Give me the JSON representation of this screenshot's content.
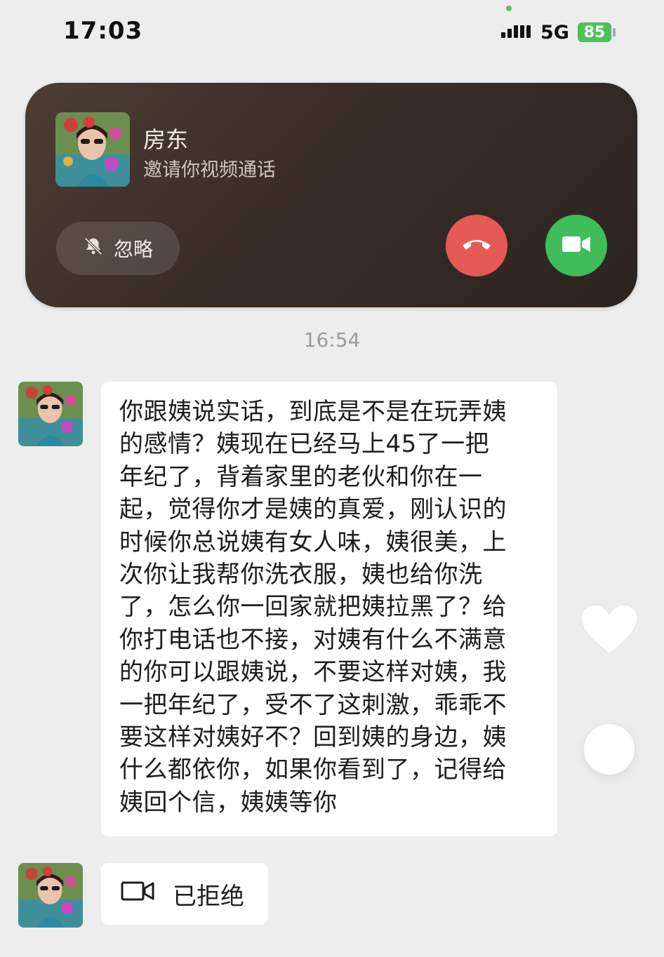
{
  "status_bar": {
    "time": "17:03",
    "network": "5G",
    "battery": "85"
  },
  "call_notification": {
    "caller_name": "房东",
    "subtitle": "邀请你视频通话",
    "ignore_label": "忽略",
    "decline_icon": "phone-hangup-icon",
    "accept_icon": "video-camera-icon"
  },
  "chat": {
    "timestamp": "16:54",
    "message_lines": [
      "你跟姨说实话，到底是不是在玩弄姨",
      "的感情？姨现在已经马上45了一把",
      "年纪了，背着家里的老伙和你在一",
      "起，觉得你才是姨的真爱，刚认识的",
      "时候你总说姨有女人味，姨很美，上",
      "次你让我帮你洗衣服，姨也给你洗",
      "了，怎么你一回家就把姨拉黑了？给",
      "你打电话也不接，对姨有什么不满意",
      "的你可以跟姨说，不要这样对姨，我",
      "一把年纪了，受不了这刺激，乖乖不",
      "要这样对姨好不？回到姨的身边，姨",
      "什么都依你，如果你看到了，记得给",
      "姨回个信，姨姨等你"
    ],
    "video_call_status": "已拒绝"
  },
  "colors": {
    "decline": "#e55a55",
    "accept": "#3fbd58",
    "battery": "#4cc15a"
  }
}
